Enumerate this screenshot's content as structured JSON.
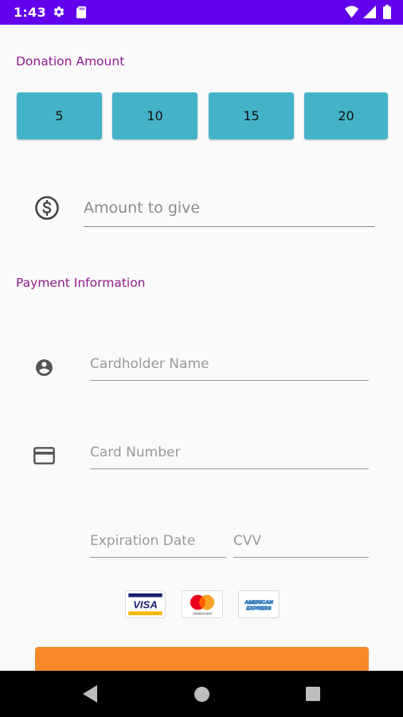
{
  "status_bar": {
    "time": "1:43",
    "background_color": "#6200ee",
    "icons": [
      "gear-icon",
      "sd-card-icon",
      "wifi-icon",
      "signal-icon",
      "battery-icon"
    ]
  },
  "donation": {
    "title": "Donation Amount",
    "amounts": [
      "5",
      "10",
      "15",
      "20"
    ],
    "button_color": "#44b3c7",
    "amount_placeholder": "Amount to give",
    "amount_value": ""
  },
  "payment": {
    "title": "Payment Information",
    "cardholder_placeholder": "Cardholder Name",
    "card_number_placeholder": "Card Number",
    "expiration_placeholder": "Expiration Date",
    "cvv_placeholder": "CVV",
    "card_brands": {
      "visa": "VISA",
      "mastercard": "mastercard",
      "amex_line1": "AMERICAN",
      "amex_line2": "EXPRESS"
    }
  },
  "colors": {
    "section_title": "#8e1a8e",
    "submit_button": "#f5892a"
  },
  "nav_bar": {
    "icons": [
      "back-icon",
      "home-icon",
      "recents-icon"
    ]
  }
}
